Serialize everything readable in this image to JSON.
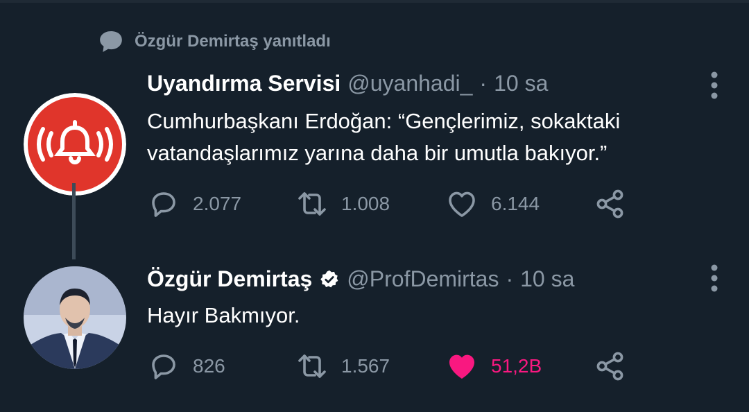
{
  "social_context": "Özgür Demirtaş yanıtladı",
  "tweets": [
    {
      "name": "Uyandırma Servisi",
      "handle": "@uyanhadi_",
      "separator": "·",
      "time": "10 sa",
      "text": "Cumhurbaşkanı Erdoğan: “Gençlerimiz, sokaktaki vatandaşlarımız yarına daha bir umutla bakıyor.”",
      "replies": "2.077",
      "retweets": "1.008",
      "likes": "6.144",
      "liked": false,
      "avatar_color": "#e0352b"
    },
    {
      "name": "Özgür Demirtaş",
      "handle": "@ProfDemirtas",
      "separator": "·",
      "time": "10 sa",
      "text": "Hayır Bakmıyor.",
      "replies": "826",
      "retweets": "1.567",
      "likes": "51,2B",
      "liked": true,
      "like_color": "#f91880"
    }
  ]
}
